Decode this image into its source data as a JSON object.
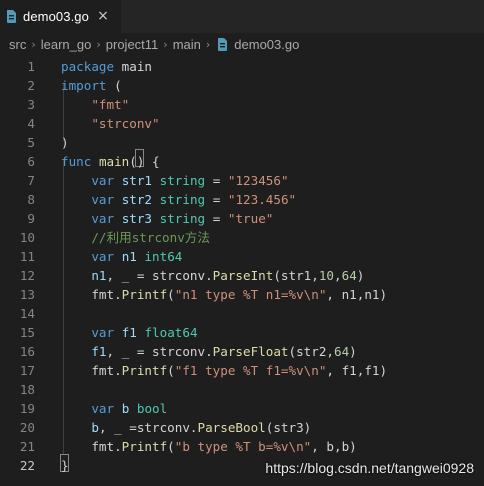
{
  "tab": {
    "label": "demo03.go",
    "icon": "go-file-icon",
    "close_icon": "×"
  },
  "breadcrumb": {
    "items": [
      "src",
      "learn_go",
      "project11",
      "main",
      "demo03.go"
    ],
    "separator": "›"
  },
  "colors": {
    "background": "#1e1e1e",
    "keyword": "#569cd6",
    "string": "#ce9178",
    "function": "#dcdcaa",
    "type": "#4ec9b0",
    "comment": "#6a9955",
    "number": "#b5cea8"
  },
  "code": {
    "active_line": 22,
    "lines": [
      {
        "n": "1",
        "tokens": [
          [
            "kw",
            "package"
          ],
          [
            "pkg",
            " main"
          ]
        ]
      },
      {
        "n": "2",
        "tokens": [
          [
            "kw",
            "import"
          ],
          [
            "pkg",
            " ("
          ]
        ]
      },
      {
        "n": "3",
        "tokens": [
          [
            "pkg",
            "    "
          ],
          [
            "str",
            "\"fmt\""
          ]
        ]
      },
      {
        "n": "4",
        "tokens": [
          [
            "pkg",
            "    "
          ],
          [
            "str",
            "\"strconv\""
          ]
        ]
      },
      {
        "n": "5",
        "tokens": [
          [
            "pkg",
            ")"
          ]
        ]
      },
      {
        "n": "6",
        "tokens": [
          [
            "kw",
            "func"
          ],
          [
            "pkg",
            " "
          ],
          [
            "fn",
            "main"
          ],
          [
            "pkg",
            "() {"
          ]
        ]
      },
      {
        "n": "7",
        "tokens": [
          [
            "pkg",
            "    "
          ],
          [
            "kw",
            "var"
          ],
          [
            "pkg",
            " "
          ],
          [
            "var",
            "str1"
          ],
          [
            "pkg",
            " "
          ],
          [
            "typ",
            "string"
          ],
          [
            "pkg",
            " = "
          ],
          [
            "str",
            "\"123456\""
          ]
        ]
      },
      {
        "n": "8",
        "tokens": [
          [
            "pkg",
            "    "
          ],
          [
            "kw",
            "var"
          ],
          [
            "pkg",
            " "
          ],
          [
            "var",
            "str2"
          ],
          [
            "pkg",
            " "
          ],
          [
            "typ",
            "string"
          ],
          [
            "pkg",
            " = "
          ],
          [
            "str",
            "\"123.456\""
          ]
        ]
      },
      {
        "n": "9",
        "tokens": [
          [
            "pkg",
            "    "
          ],
          [
            "kw",
            "var"
          ],
          [
            "pkg",
            " "
          ],
          [
            "var",
            "str3"
          ],
          [
            "pkg",
            " "
          ],
          [
            "typ",
            "string"
          ],
          [
            "pkg",
            " = "
          ],
          [
            "str",
            "\"true\""
          ]
        ]
      },
      {
        "n": "10",
        "tokens": [
          [
            "pkg",
            "    "
          ],
          [
            "com",
            "//利用strconv方法"
          ]
        ]
      },
      {
        "n": "11",
        "tokens": [
          [
            "pkg",
            "    "
          ],
          [
            "kw",
            "var"
          ],
          [
            "pkg",
            " "
          ],
          [
            "var",
            "n1"
          ],
          [
            "pkg",
            " "
          ],
          [
            "typ",
            "int64"
          ]
        ]
      },
      {
        "n": "12",
        "tokens": [
          [
            "pkg",
            "    "
          ],
          [
            "var",
            "n1"
          ],
          [
            "pkg",
            ", _ = strconv."
          ],
          [
            "fn",
            "ParseInt"
          ],
          [
            "pkg",
            "(str1,"
          ],
          [
            "num",
            "10"
          ],
          [
            "pkg",
            ","
          ],
          [
            "num",
            "64"
          ],
          [
            "pkg",
            ")"
          ]
        ]
      },
      {
        "n": "13",
        "tokens": [
          [
            "pkg",
            "    fmt."
          ],
          [
            "fn",
            "Printf"
          ],
          [
            "pkg",
            "("
          ],
          [
            "str",
            "\"n1 type %T n1=%v\\n\""
          ],
          [
            "pkg",
            ", n1,n1)"
          ]
        ]
      },
      {
        "n": "14",
        "tokens": []
      },
      {
        "n": "15",
        "tokens": [
          [
            "pkg",
            "    "
          ],
          [
            "kw",
            "var"
          ],
          [
            "pkg",
            " "
          ],
          [
            "var",
            "f1"
          ],
          [
            "pkg",
            " "
          ],
          [
            "typ",
            "float64"
          ]
        ]
      },
      {
        "n": "16",
        "tokens": [
          [
            "pkg",
            "    "
          ],
          [
            "var",
            "f1"
          ],
          [
            "pkg",
            ", _ = strconv."
          ],
          [
            "fn",
            "ParseFloat"
          ],
          [
            "pkg",
            "(str2,"
          ],
          [
            "num",
            "64"
          ],
          [
            "pkg",
            ")"
          ]
        ]
      },
      {
        "n": "17",
        "tokens": [
          [
            "pkg",
            "    fmt."
          ],
          [
            "fn",
            "Printf"
          ],
          [
            "pkg",
            "("
          ],
          [
            "str",
            "\"f1 type %T f1=%v\\n\""
          ],
          [
            "pkg",
            ", f1,f1)"
          ]
        ]
      },
      {
        "n": "18",
        "tokens": []
      },
      {
        "n": "19",
        "tokens": [
          [
            "pkg",
            "    "
          ],
          [
            "kw",
            "var"
          ],
          [
            "pkg",
            " "
          ],
          [
            "var",
            "b"
          ],
          [
            "pkg",
            " "
          ],
          [
            "typ",
            "bool"
          ]
        ]
      },
      {
        "n": "20",
        "tokens": [
          [
            "pkg",
            "    "
          ],
          [
            "var",
            "b"
          ],
          [
            "pkg",
            ", _ =strconv."
          ],
          [
            "fn",
            "ParseBool"
          ],
          [
            "pkg",
            "(str3)"
          ]
        ]
      },
      {
        "n": "21",
        "tokens": [
          [
            "pkg",
            "    fmt."
          ],
          [
            "fn",
            "Printf"
          ],
          [
            "pkg",
            "("
          ],
          [
            "str",
            "\"b type %T b=%v\\n\""
          ],
          [
            "pkg",
            ", b,b)"
          ]
        ]
      },
      {
        "n": "22",
        "tokens": [
          [
            "pkg",
            "}"
          ]
        ]
      }
    ]
  },
  "watermark": "https://blog.csdn.net/tangwei0928"
}
